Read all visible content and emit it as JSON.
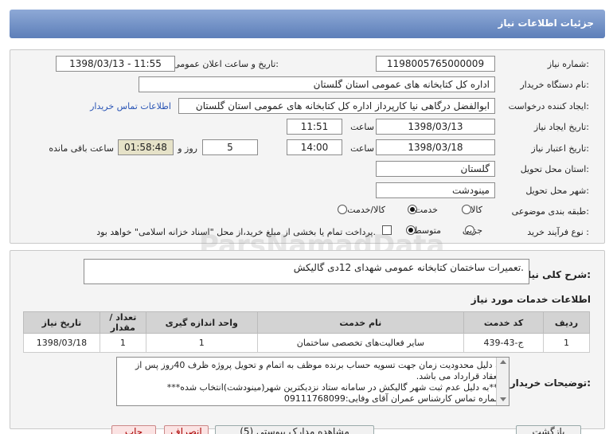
{
  "header": {
    "title": "جزئیات اطلاعات نیاز"
  },
  "fields": {
    "need_number_label": "شماره نیاز:",
    "need_number": "1198005765000009",
    "announce_label": "تاریخ و ساعت اعلان عمومی:",
    "announce_value": "1398/03/13 - 11:55",
    "buyer_label": "نام دستگاه خریدار:",
    "buyer": "اداره کل کتابخانه های عمومی استان گلستان",
    "requester_label": "ایجاد کننده درخواست:",
    "requester": "ابوالفضل  درگاهی نیا کارپرداز اداره کل کتابخانه های عمومی استان گلستان",
    "contact_link": "اطلاعات تماس خریدار",
    "created_label": "تاریخ ایجاد نیاز:",
    "created_date": "1398/03/13",
    "time_label": "ساعت",
    "created_time": "11:51",
    "validity_label": "تاریخ اعتبار نیاز:",
    "validity_date": "1398/03/18",
    "validity_time": "14:00",
    "days": "5",
    "days_label": "روز و",
    "remaining": "01:58:48",
    "remaining_label": "ساعت باقی مانده",
    "province_label": "استان محل تحویل:",
    "province": "گلستان",
    "city_label": "شهر محل تحویل:",
    "city": "مینودشت",
    "category_label": "طبقه بندی موضوعی:",
    "category_options": [
      "کالا",
      "خدمت",
      "کالا/خدمت"
    ],
    "category_selected": "خدمت",
    "process_label": "نوع فرآیند خرید :",
    "process_options": [
      "جزیی",
      "متوسط"
    ],
    "process_selected": "متوسط",
    "payment_note": "پرداخت تمام یا بخشی از مبلغ خرید،از محل \"اسناد خزانه اسلامی\" خواهد بود."
  },
  "summary": {
    "label": "شرح کلی نیاز:",
    "text": "تعمیرات ساختمان کتابخانه عمومی شهدای 12دی گالیکش."
  },
  "services": {
    "section_title": "اطلاعات خدمات مورد نیاز",
    "columns": [
      "ردیف",
      "کد خدمت",
      "نام خدمت",
      "واحد اندازه گیری",
      "تعداد / مقدار",
      "تاریخ نیاز"
    ],
    "rows": [
      [
        "1",
        "ج-43-439",
        "سایر فعالیت‌های تخصصی ساختمان",
        "1",
        "1",
        "1398/03/18"
      ]
    ]
  },
  "notes": {
    "label": "توضیحات خریدار:",
    "lines": [
      "به دلیل محدودیت زمان جهت تسویه حساب برنده موظف به اتمام و تحویل پروژه ظرف 40روز پس از انعقاد قرارداد می باشد.",
      "***به دلیل عدم ثبت شهر گالیکش در سامانه ستاد نزدیکترین شهر(مینودشت)انتخاب شده***",
      "شماره تماس کارشناس عمران آقای وفایی:09111768099"
    ]
  },
  "watermark": {
    "line1": "ParsNamadData",
    "line2": "پارس نماد داده ها",
    "line3": "پایگاه اطلاع رسانی مناقصه ومزایده",
    "line4": "۰۲۱-۸۸۳۴۹۶۷۰"
  },
  "buttons": {
    "b1": "بازگشت",
    "b2": "مشاهده مدارک پیوستی (5)",
    "b3": "انصراف",
    "b4": "چاپ"
  }
}
